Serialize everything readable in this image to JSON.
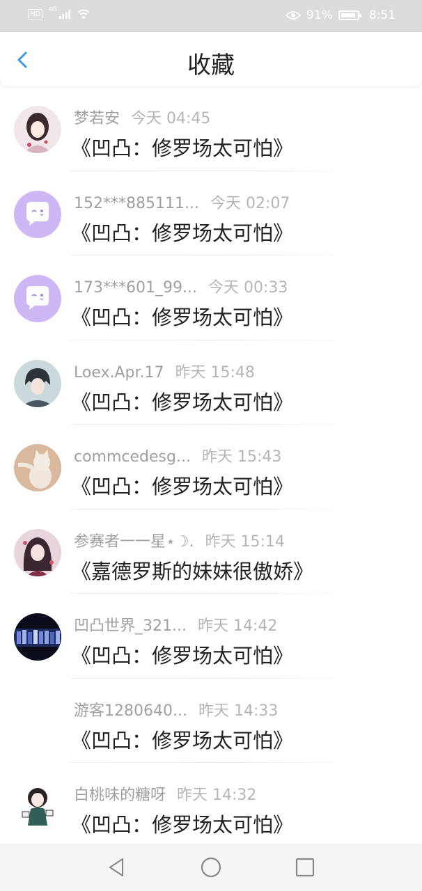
{
  "status_bar": {
    "hd_label": "HD",
    "network_label": "4G",
    "battery_percent_text": "91%",
    "battery_level": 0.91,
    "time": "8:51"
  },
  "header": {
    "title": "收藏"
  },
  "list": [
    {
      "name": "梦若安",
      "time": "今天 04:45",
      "work": "《凹凸：修罗场太可怕》",
      "avatar": "anime-girl-avatar"
    },
    {
      "name": "152***885111...",
      "time": "今天 02:07",
      "work": "《凹凸：修罗场太可怕》",
      "avatar": "default-chat-avatar"
    },
    {
      "name": "173***601_99...",
      "time": "今天 00:33",
      "work": "《凹凸：修罗场太可怕》",
      "avatar": "default-chat-avatar"
    },
    {
      "name": "Loex.Apr.17",
      "time": "昨天 15:48",
      "work": "《凹凸：修罗场太可怕》",
      "avatar": "anime-boy-avatar"
    },
    {
      "name": "commcedesg...",
      "time": "昨天 15:43",
      "work": "《凹凸：修罗场太可怕》",
      "avatar": "cat-avatar"
    },
    {
      "name": "参赛者一一星⋆☽.",
      "time": "昨天 15:14",
      "work": "《嘉德罗斯的妹妹很傲娇》",
      "avatar": "anime-girl-dark-avatar"
    },
    {
      "name": "凹凸世界_321...",
      "time": "昨天 14:42",
      "work": "《凹凸：修罗场太可怕》",
      "avatar": "group-banner-avatar"
    },
    {
      "name": "游客1280640...",
      "time": "昨天 14:33",
      "work": "《凹凸：修罗场太可怕》",
      "avatar": ""
    },
    {
      "name": "白桃味的糖呀",
      "time": "昨天 14:32",
      "work": "《凹凸：修罗场太可怕》",
      "avatar": "chibi-avatar"
    }
  ],
  "colors": {
    "accent": "#3a98e8",
    "default_avatar_bg": "#cdb7f5"
  }
}
